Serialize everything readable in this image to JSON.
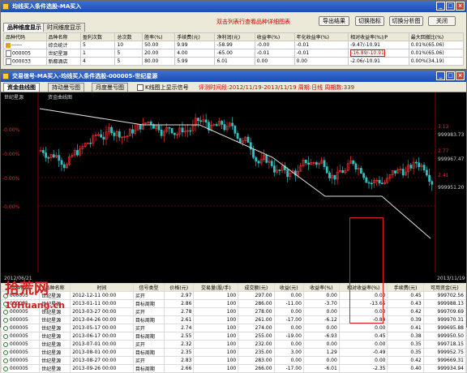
{
  "main_window": {
    "title": "均线买入条件选股-MA买入",
    "hint": "双击列表行查看品种详细图表",
    "buttons": [
      "导出结果",
      "切换指标",
      "切换分析图",
      "关闭"
    ],
    "tabs": [
      "品种维度显示",
      "时间维度显示"
    ],
    "columns": [
      "品种代码",
      "品种名称",
      "盈利次数",
      "总次数",
      "胜率(%)",
      "手续费(元)",
      "净利润(元)",
      "收益率(%)",
      "年化收益率(%)",
      "相对收益率(%)/P",
      "最大回撤比(%)"
    ],
    "rows": [
      [
        "------",
        "综合统计",
        "5",
        "10",
        "50.00",
        "9.99",
        "-58.99",
        "-0.00",
        "-0.01",
        "-9.47/-10.91",
        "0.01%(65.06)"
      ],
      [
        "000005",
        "世纪星源",
        "1",
        "5",
        "20.00",
        "4.00",
        "-65.00",
        "-0.01",
        "-0.01",
        "-16.89/-10.91",
        "0.01%(65.06)"
      ],
      [
        "000033",
        "新都酒店",
        "4",
        "5",
        "80.00",
        "5.99",
        "6.01",
        "0.00",
        "0.00",
        "-2.06/-10.91",
        "0.00%(34.19)"
      ]
    ]
  },
  "chart_window": {
    "title": "交易信号-MA买入-均线买入条件选股-000005-世纪星源",
    "tabs": [
      "资金曲线图",
      "持动曼亏图",
      "月度曼亏图"
    ],
    "checkbox_label": "K线图上显示信号",
    "info": "评测时间段:2012/11/19-2013/11/19  周期:日线  周期数:339",
    "legend": [
      "世纪星源",
      "资金曲线图"
    ],
    "left_ticks": [
      "-0.00%",
      "-0.00%",
      "-0.00%",
      "-0.00%"
    ],
    "price_ticks": [
      "3.13",
      "2.77",
      "2.41"
    ],
    "equity_ticks": [
      "999983.73",
      "999967.47",
      "999951.20"
    ],
    "date_start": "2012/06/21",
    "date_end": "2013/11/19",
    "columns": [
      "品种代码",
      "品种名称",
      "时间",
      "信号类型",
      "价格(元)",
      "交易量(股/手)",
      "成交额(元)",
      "收益(元)",
      "收益率(%)",
      "相对收益率(%)",
      "手续费(元)",
      "可用资金(元)"
    ],
    "rows": [
      [
        "000005",
        "世纪星源",
        "2012-12-11 00:00",
        "买开",
        "2.97",
        "100",
        "297.00",
        "0.00",
        "0.00",
        "0.00",
        "0.45",
        "999702.56"
      ],
      [
        "000005",
        "世纪星源",
        "2013-01-11 00:00",
        "目标周期",
        "2.86",
        "100",
        "286.00",
        "-11.00",
        "-3.70",
        "-13.65",
        "0.43",
        "999988.13"
      ],
      [
        "000005",
        "世纪星源",
        "2013-03-27 00:00",
        "买开",
        "2.78",
        "100",
        "278.00",
        "0.00",
        "0.00",
        "0.00",
        "0.42",
        "999709.69"
      ],
      [
        "000005",
        "世纪星源",
        "2013-04-26 00:00",
        "目标周期",
        "2.61",
        "100",
        "261.00",
        "-17.00",
        "-6.12",
        "-0.84",
        "0.39",
        "999970.31"
      ],
      [
        "000005",
        "世纪星源",
        "2013-05-17 00:00",
        "买开",
        "2.74",
        "100",
        "274.00",
        "0.00",
        "0.00",
        "0.00",
        "0.41",
        "999695.88"
      ],
      [
        "000005",
        "世纪星源",
        "2013-06-17 00:00",
        "目标周期",
        "2.55",
        "100",
        "255.00",
        "-19.00",
        "-6.93",
        "0.45",
        "0.38",
        "999950.50"
      ],
      [
        "000005",
        "世纪星源",
        "2013-07-01 00:00",
        "买开",
        "2.32",
        "100",
        "232.00",
        "0.00",
        "0.00",
        "0.00",
        "0.35",
        "999718.15"
      ],
      [
        "000005",
        "世纪星源",
        "2013-08-01 00:00",
        "目标周期",
        "2.35",
        "100",
        "235.00",
        "3.00",
        "1.29",
        "-0.49",
        "0.35",
        "999952.75"
      ],
      [
        "000005",
        "世纪星源",
        "2013-08-27 00:00",
        "买开",
        "2.83",
        "100",
        "283.00",
        "0.00",
        "0.00",
        "0.00",
        "0.42",
        "999669.31"
      ],
      [
        "000005",
        "世纪星源",
        "2013-09-26 00:00",
        "目标周期",
        "2.66",
        "100",
        "266.00",
        "-17.00",
        "-6.01",
        "-2.35",
        "0.40",
        "999934.94"
      ]
    ]
  },
  "watermark": {
    "main": "拾荒网",
    "sub": "10Huang.cn"
  }
}
